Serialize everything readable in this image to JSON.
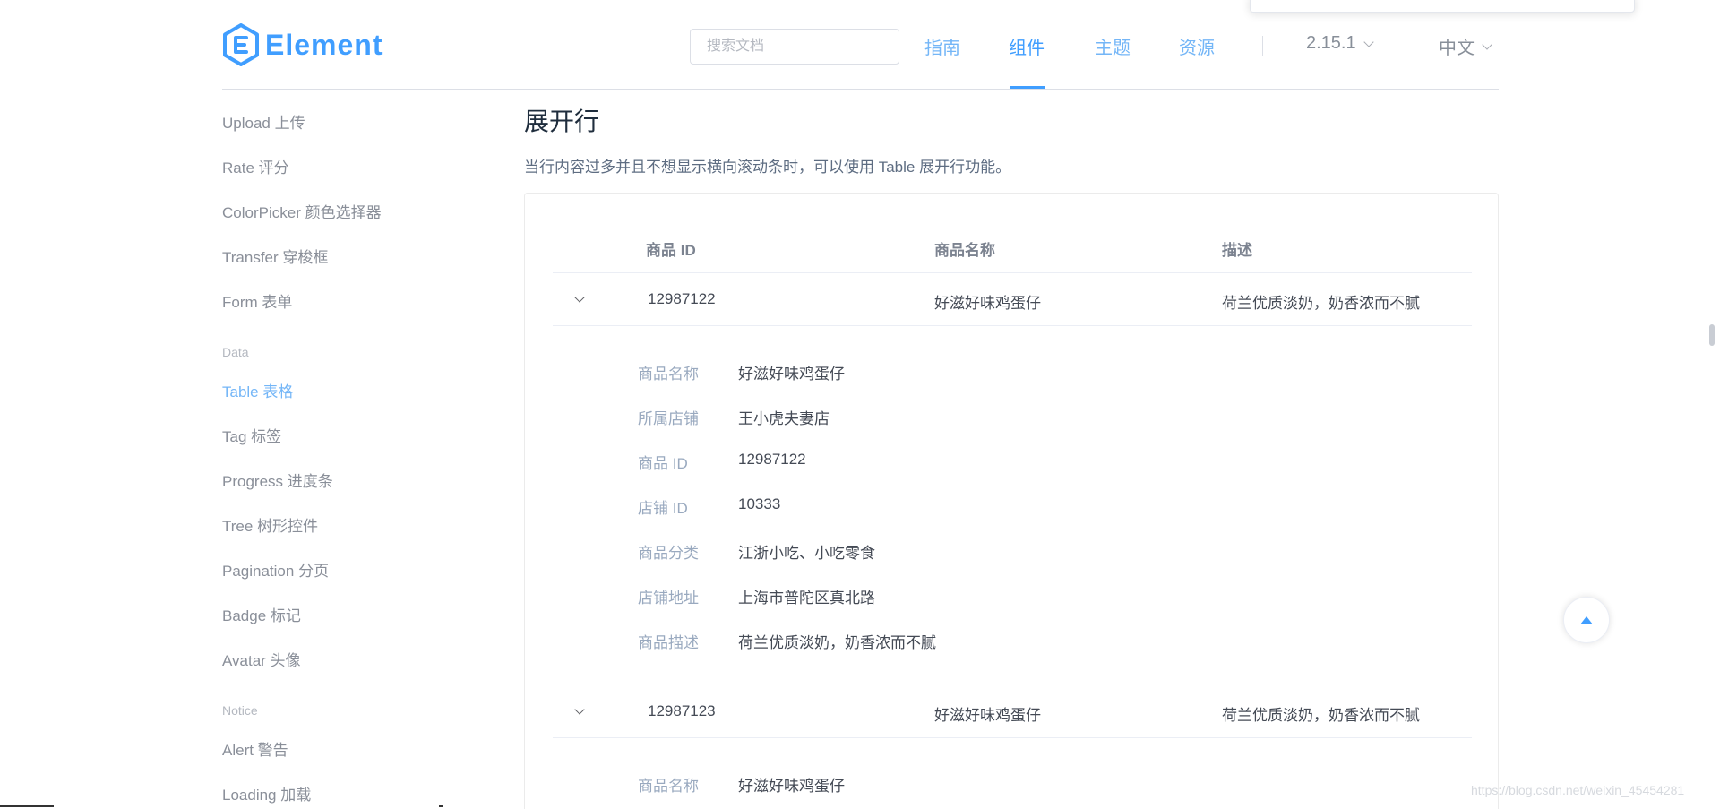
{
  "header": {
    "logo_text": "Element",
    "search_placeholder": "搜索文档",
    "nav": [
      "指南",
      "组件",
      "主题",
      "资源"
    ],
    "active_nav": "组件",
    "version": "2.15.1",
    "language": "中文"
  },
  "sidebar": {
    "items_top": [
      "Upload 上传",
      "Rate 评分",
      "ColorPicker 颜色选择器",
      "Transfer 穿梭框",
      "Form 表单"
    ],
    "group_data": "Data",
    "items_data": [
      "Table 表格",
      "Tag 标签",
      "Progress 进度条",
      "Tree 树形控件",
      "Pagination 分页",
      "Badge 标记",
      "Avatar 头像"
    ],
    "active_item": "Table 表格",
    "group_notice": "Notice",
    "items_notice": [
      "Alert 警告",
      "Loading 加载"
    ]
  },
  "main": {
    "title": "展开行",
    "description": "当行内容过多并且不想显示横向滚动条时，可以使用 Table 展开行功能。"
  },
  "table": {
    "headers": [
      "商品 ID",
      "商品名称",
      "描述"
    ],
    "rows": [
      {
        "id": "12987122",
        "name": "好滋好味鸡蛋仔",
        "desc": "荷兰优质淡奶，奶香浓而不腻",
        "expanded": [
          {
            "label": "商品名称",
            "value": "好滋好味鸡蛋仔"
          },
          {
            "label": "所属店铺",
            "value": "王小虎夫妻店"
          },
          {
            "label": "商品 ID",
            "value": "12987122"
          },
          {
            "label": "店铺 ID",
            "value": "10333"
          },
          {
            "label": "商品分类",
            "value": "江浙小吃、小吃零食"
          },
          {
            "label": "店铺地址",
            "value": "上海市普陀区真北路"
          },
          {
            "label": "商品描述",
            "value": "荷兰优质淡奶，奶香浓而不腻"
          }
        ]
      },
      {
        "id": "12987123",
        "name": "好滋好味鸡蛋仔",
        "desc": "荷兰优质淡奶，奶香浓而不腻",
        "expanded": [
          {
            "label": "商品名称",
            "value": "好滋好味鸡蛋仔"
          }
        ]
      }
    ]
  },
  "watermark": "https://blog.csdn.net/weixin_45454281",
  "colors": {
    "brand": "#409eff",
    "nav_inactive": "#74b6f7",
    "border": "#ebeef5",
    "label": "#99a9bf"
  },
  "icons": {
    "expand": "chevron-down-icon",
    "back_to_top": "caret-up-icon",
    "logo": "element-hexagon-logo"
  }
}
